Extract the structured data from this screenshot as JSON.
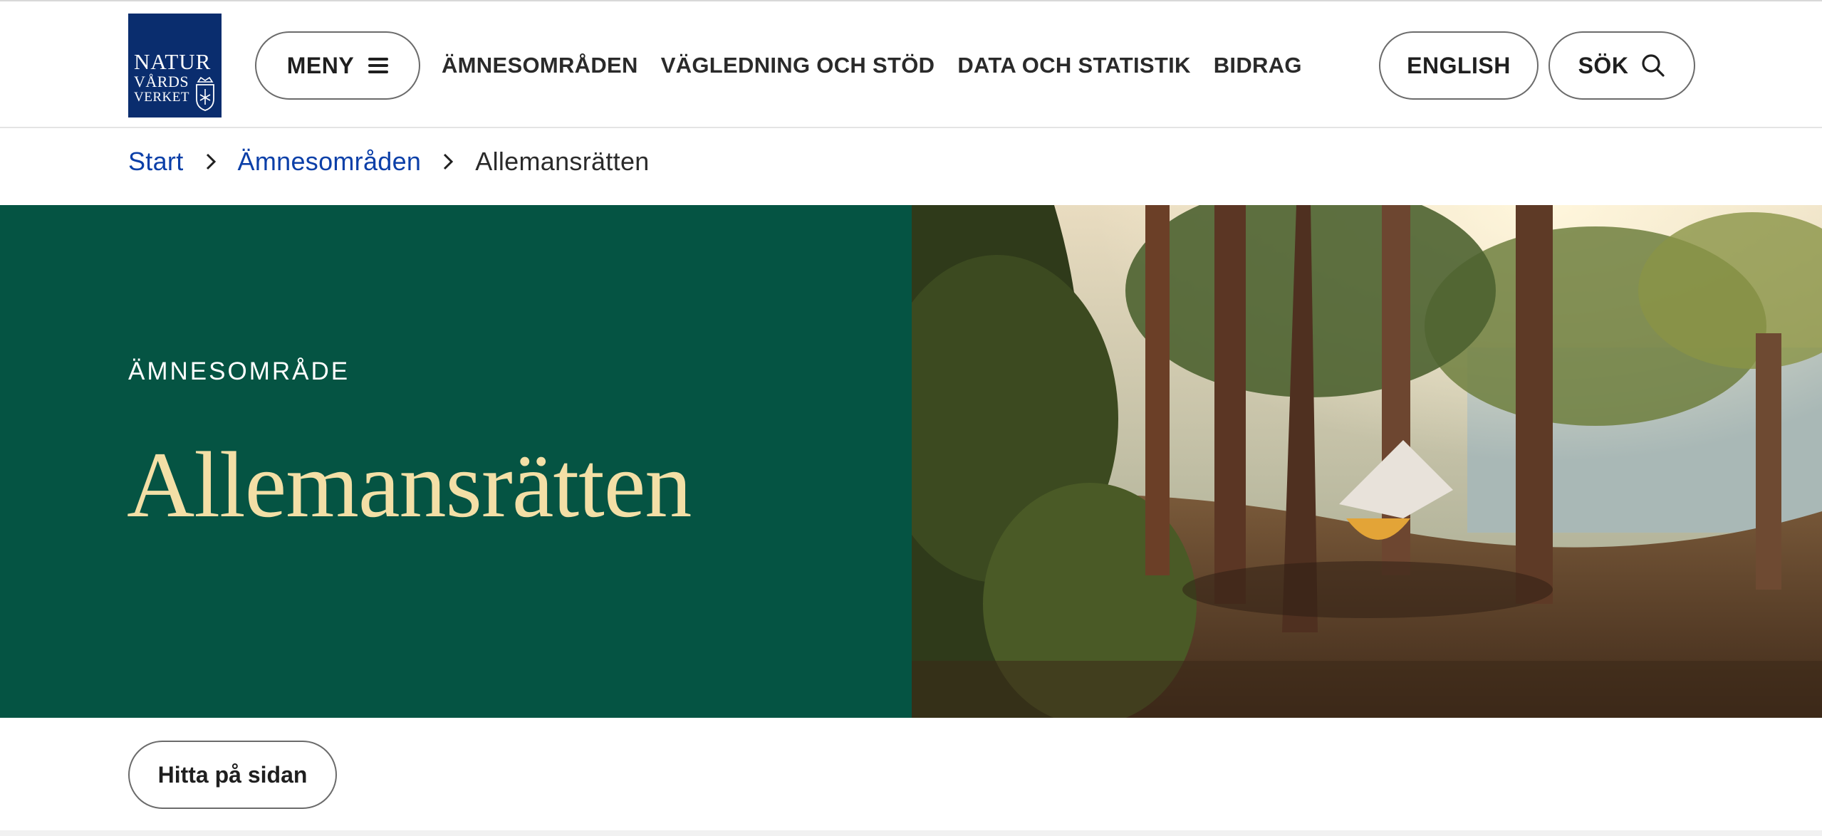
{
  "logo": {
    "line1": "NATUR",
    "line2": "VÅRDS",
    "line3": "VERKET"
  },
  "header": {
    "menu_label": "MENY",
    "nav": [
      "ÄMNESOMRÅDEN",
      "VÄGLEDNING OCH STÖD",
      "DATA OCH STATISTIK",
      "BIDRAG"
    ],
    "english_label": "ENGLISH",
    "search_label": "SÖK"
  },
  "breadcrumb": {
    "start": "Start",
    "section": "Ämnesområden",
    "current": "Allemansrätten"
  },
  "hero": {
    "eyebrow": "ÄMNESOMRÅDE",
    "title": "Allemansrätten",
    "background": "#055443",
    "title_color": "#f3dfa6",
    "photo_icon": "forest-hammock-photo"
  },
  "find_on_page_label": "Hitta på sidan",
  "colors": {
    "logo_blue": "#0a2d6e",
    "link_blue": "#0b3fa8"
  }
}
